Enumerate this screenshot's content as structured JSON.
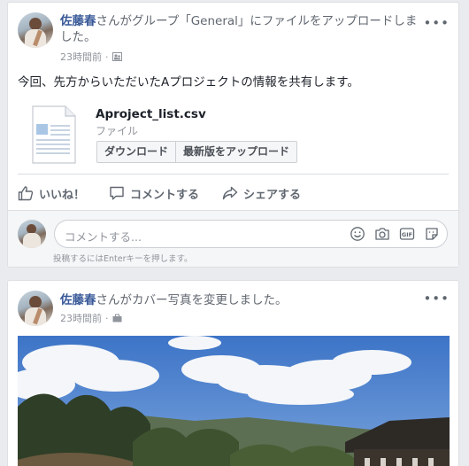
{
  "post1": {
    "author": "佐藤春",
    "headline_rest": "さんがグループ「General」にファイルをアップロードしました。",
    "time": "23時間前",
    "audience_icon": "group-icon",
    "body": "今回、先方からいただいたAプロジェクトの情報を共有します。",
    "file": {
      "name": "Aproject_list.csv",
      "type": "ファイル",
      "download_label": "ダウンロード",
      "upload_label": "最新版をアップロード"
    },
    "actions": {
      "like": "いいね！",
      "comment": "コメントする",
      "share": "シェアする"
    },
    "comment_box": {
      "placeholder": "コメントする...",
      "hint": "投稿するにはEnterキーを押します。",
      "icons": [
        "emoji-icon",
        "camera-icon",
        "gif-icon",
        "sticker-icon"
      ]
    }
  },
  "post2": {
    "author": "佐藤春",
    "headline_rest": "さんがカバー写真を変更しました。",
    "time": "23時間前",
    "audience_icon": "briefcase-icon"
  },
  "more_options": "•••",
  "colors": {
    "link": "#385898",
    "secondary_text": "#90949c",
    "background": "#e9ebee"
  }
}
